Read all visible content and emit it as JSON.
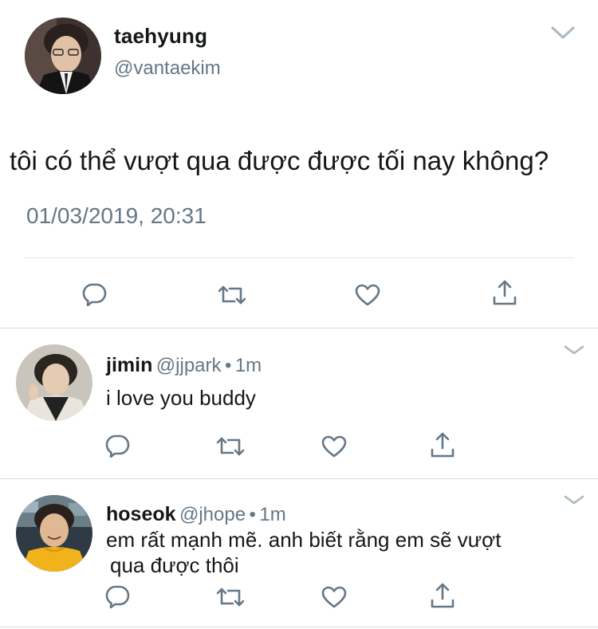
{
  "main_tweet": {
    "name": "taehyung",
    "handle": "@vantaekim",
    "text": "tôi có thể vượt qua được được tối nay không?",
    "timestamp": "01/03/2019, 20:31",
    "actions": [
      "reply-icon",
      "retweet-icon",
      "like-icon",
      "share-icon"
    ]
  },
  "replies": [
    {
      "name": "jimin",
      "handle": "@jjpark",
      "dot": "•",
      "time": "1m",
      "text_lines": [
        "i love you buddy"
      ]
    },
    {
      "name": "hoseok",
      "handle": "@jhope",
      "dot": "•",
      "time": "1m",
      "text_lines": [
        "em rất mạnh mẽ. anh biết rằng em sẽ vượt",
        "qua được thôi"
      ]
    }
  ],
  "colors": {
    "text": "#14171a",
    "secondary": "#657786",
    "caret": "#aab8c2",
    "divider": "#e1e8ed"
  }
}
